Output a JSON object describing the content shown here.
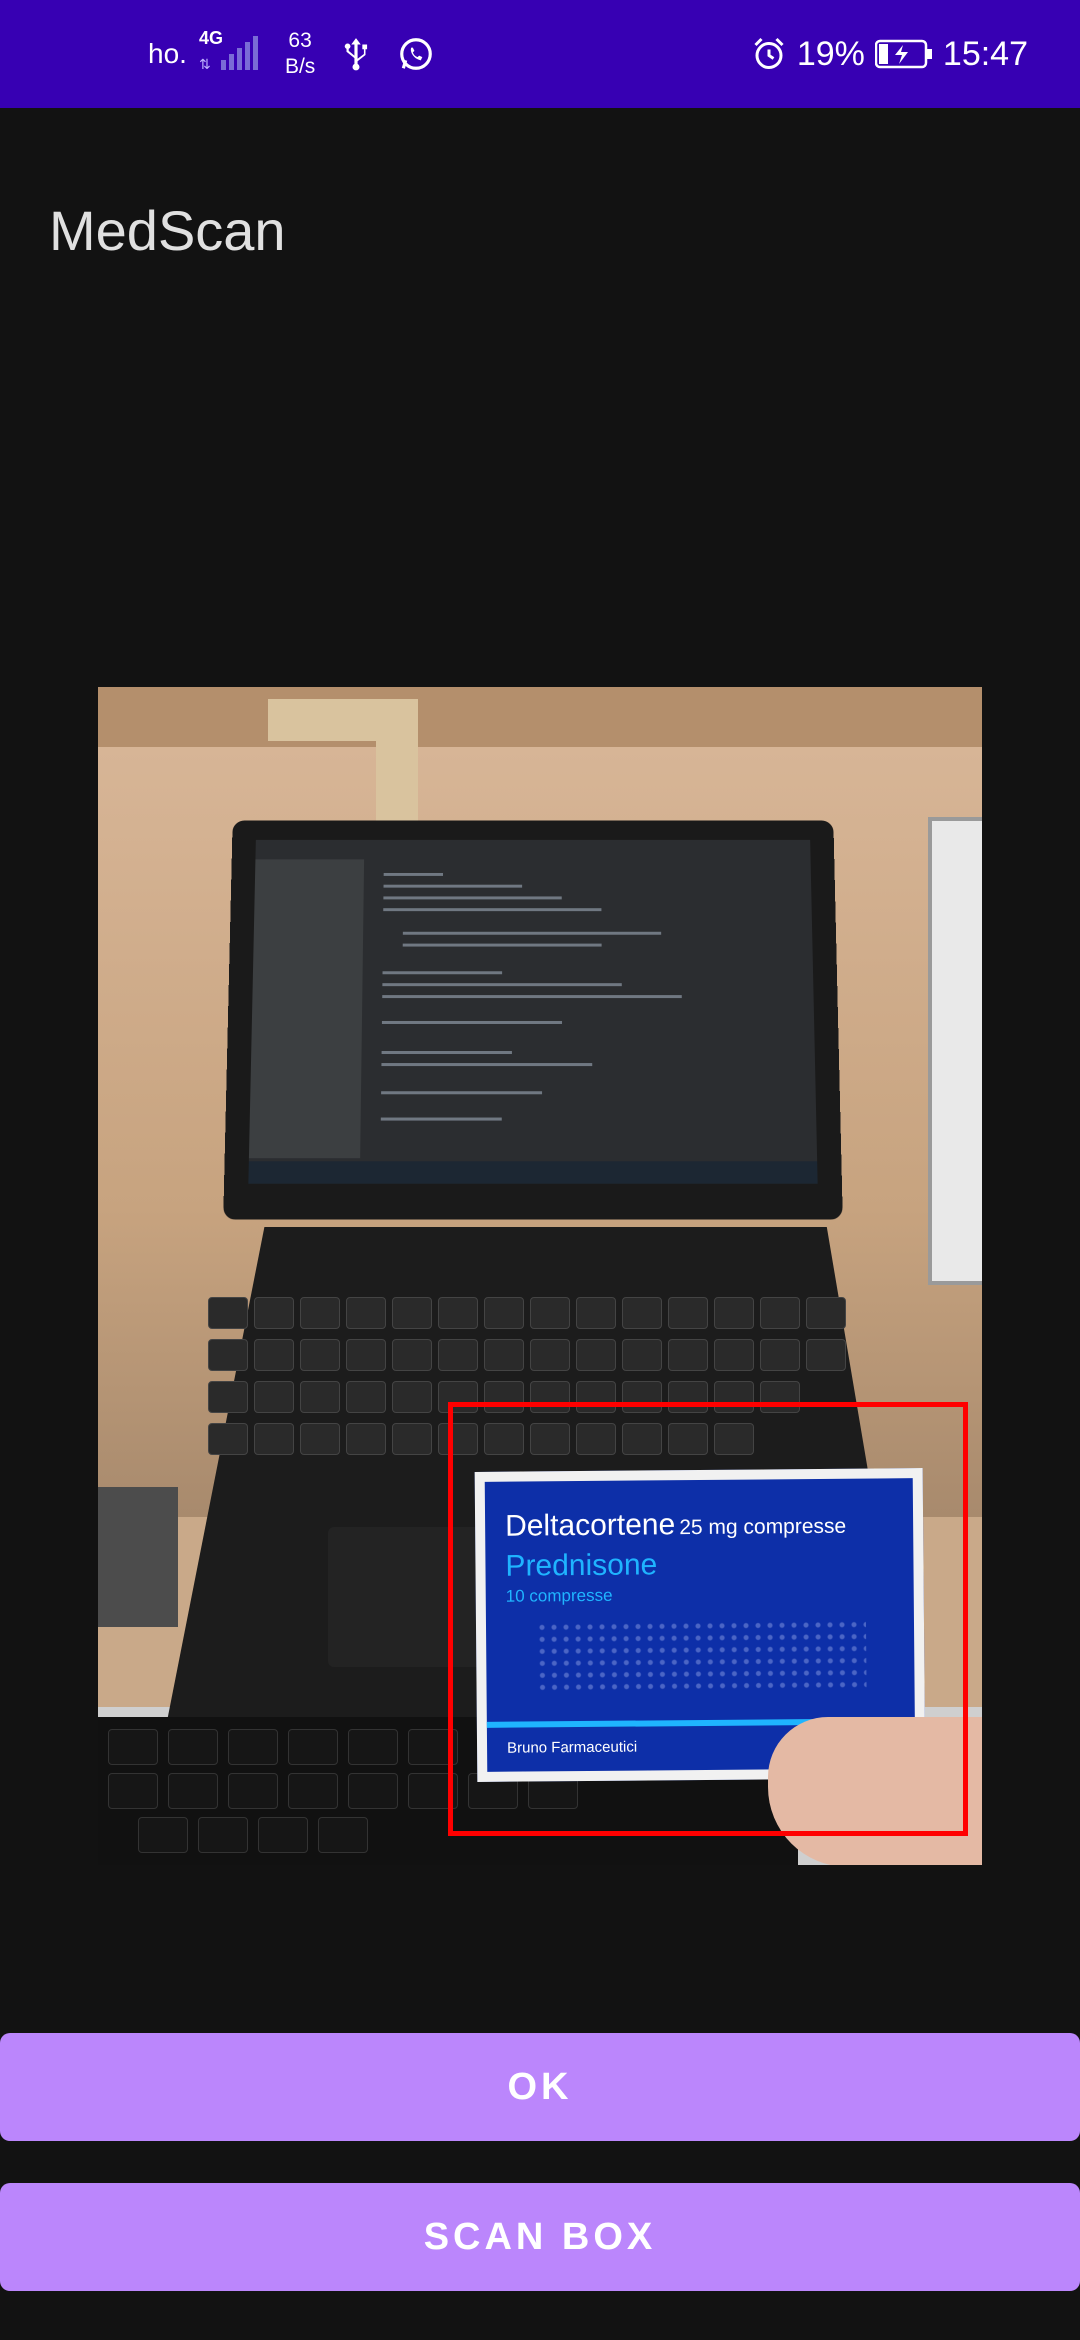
{
  "status_bar": {
    "carrier": "ho.",
    "network": "4G",
    "speed_value": "63",
    "speed_unit": "B/s",
    "battery": "19%",
    "time": "15:47",
    "icons": [
      "signal-icon",
      "usb-icon",
      "whatsapp-icon",
      "alarm-icon",
      "battery-charging-icon"
    ]
  },
  "app": {
    "title": "MedScan"
  },
  "photo": {
    "medicine_box": {
      "brand": "Deltacortene",
      "dose": "25 mg compresse",
      "generic": "Prednisone",
      "count": "10 compresse",
      "manufacturer": "Bruno Farmaceutici"
    },
    "detection_color": "#FF0000"
  },
  "buttons": {
    "ok_label": "OK",
    "scan_label": "SCAN BOX"
  },
  "colors": {
    "status_bar": "#3700B3",
    "background": "#121212",
    "button": "#BB86FC"
  }
}
